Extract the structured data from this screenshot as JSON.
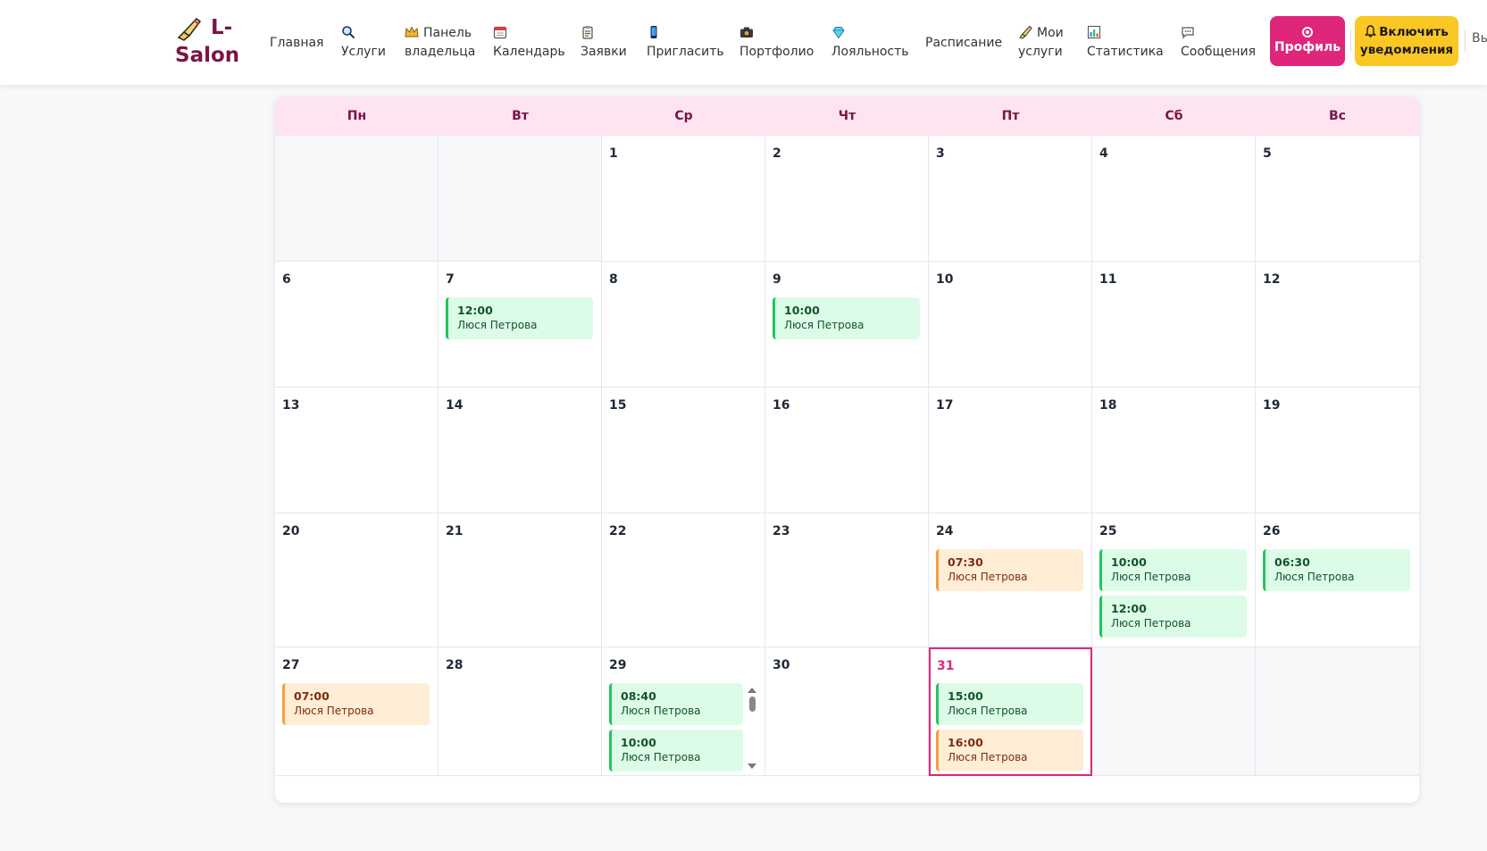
{
  "header": {
    "logo_line1": "L-",
    "logo_line2": "Salon",
    "nav": [
      {
        "icon": "none",
        "lines": [
          "Главная"
        ]
      },
      {
        "icon": "magnifier-icon",
        "lines": [
          "Услуги"
        ]
      },
      {
        "icon": "crown-icon",
        "lines": [
          "Панель",
          "владельца"
        ]
      },
      {
        "icon": "calendar-icon",
        "lines": [
          "Календарь"
        ]
      },
      {
        "icon": "clipboard-icon",
        "lines": [
          "Заявки"
        ]
      },
      {
        "icon": "phone-icon",
        "lines": [
          "Пригласить"
        ]
      },
      {
        "icon": "camera-icon",
        "lines": [
          "Портфолио"
        ]
      },
      {
        "icon": "diamond-icon",
        "lines": [
          "Лояльность"
        ]
      },
      {
        "icon": "none",
        "lines": [
          "Расписание"
        ]
      },
      {
        "icon": "brush-icon",
        "lines": [
          "Мои",
          "услуги"
        ]
      },
      {
        "icon": "chart-icon",
        "lines": [
          "Статистика"
        ]
      },
      {
        "icon": "chat-icon",
        "lines": [
          "Сообщения"
        ]
      }
    ],
    "profile_label": "Профиль",
    "notify_line1": "Включить",
    "notify_line2": "уведомления",
    "exit_label": "Вы"
  },
  "calendar": {
    "days_of_week": [
      "Пн",
      "Вт",
      "Ср",
      "Чт",
      "Пт",
      "Сб",
      "Вс"
    ],
    "weeks": [
      [
        null,
        null,
        1,
        2,
        3,
        4,
        5
      ],
      [
        6,
        7,
        8,
        9,
        10,
        11,
        12
      ],
      [
        13,
        14,
        15,
        16,
        17,
        18,
        19
      ],
      [
        20,
        21,
        22,
        23,
        24,
        25,
        26
      ],
      [
        27,
        28,
        29,
        30,
        31,
        null,
        null
      ]
    ],
    "today": 31,
    "events": {
      "7": [
        {
          "time": "12:00",
          "name": "Люся Петрова",
          "status": "green"
        }
      ],
      "9": [
        {
          "time": "10:00",
          "name": "Люся Петрова",
          "status": "green"
        }
      ],
      "24": [
        {
          "time": "07:30",
          "name": "Люся Петрова",
          "status": "orange"
        }
      ],
      "25": [
        {
          "time": "10:00",
          "name": "Люся Петрова",
          "status": "green"
        },
        {
          "time": "12:00",
          "name": "Люся Петрова",
          "status": "green"
        }
      ],
      "26": [
        {
          "time": "06:30",
          "name": "Люся Петрова",
          "status": "green"
        }
      ],
      "27": [
        {
          "time": "07:00",
          "name": "Люся Петрова",
          "status": "orange"
        }
      ],
      "29": [
        {
          "time": "08:40",
          "name": "Люся Петрова",
          "status": "green"
        },
        {
          "time": "10:00",
          "name": "Люся Петрова",
          "status": "green"
        }
      ],
      "31": [
        {
          "time": "15:00",
          "name": "Люся Петрова",
          "status": "green"
        },
        {
          "time": "16:00",
          "name": "Люся Петрова",
          "status": "orange"
        }
      ]
    },
    "scrollable_day": 29
  },
  "colors": {
    "brand": "#7a1446",
    "accent_pink": "#e0267a",
    "notify_yellow": "#fbc724",
    "event_green": "#dcfce7",
    "event_orange": "#ffedd5",
    "header_row": "#fde4f0"
  }
}
